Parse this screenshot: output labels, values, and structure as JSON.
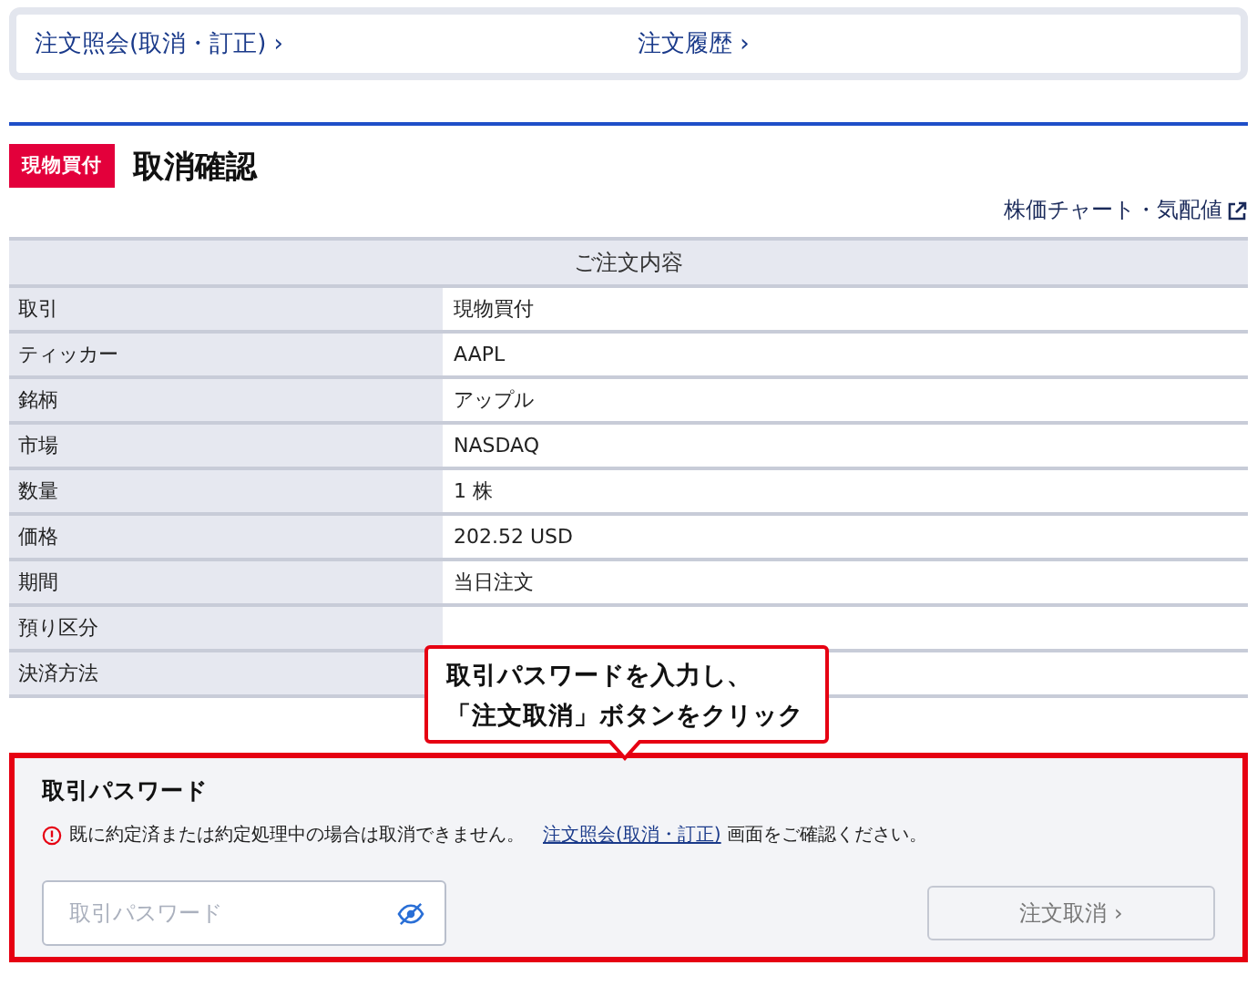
{
  "nav_links": [
    {
      "label": "注文照会(取消・訂正)",
      "chevron": "›"
    },
    {
      "label": "注文履歴",
      "chevron": "›"
    }
  ],
  "header": {
    "badge": "現物買付",
    "title": "取消確認",
    "chart_link": "株価チャート・気配値"
  },
  "table": {
    "heading": "ご注文内容",
    "rows": [
      {
        "label": "取引",
        "value": "現物買付"
      },
      {
        "label": "ティッカー",
        "value": "AAPL"
      },
      {
        "label": "銘柄",
        "value": "アップル"
      },
      {
        "label": "市場",
        "value": "NASDAQ"
      },
      {
        "label": "数量",
        "value": "1 株"
      },
      {
        "label": "価格",
        "value": "202.52 USD"
      },
      {
        "label": "期間",
        "value": "当日注文"
      },
      {
        "label": "預り区分"
      },
      {
        "label": "決済方法"
      }
    ]
  },
  "callout": {
    "lines": [
      "取引パスワードを入力し、",
      "「注文取消」ボタンをクリック"
    ]
  },
  "password_section": {
    "title": "取引パスワード",
    "notice_before": "既に約定済または約定処理中の場合は取消できません。",
    "notice_link": "注文照会(取消・訂正)",
    "notice_after": "画面をご確認ください。",
    "placeholder": "取引パスワード",
    "button": "注文取消",
    "button_chevron": "›",
    "button_disabled": true
  }
}
